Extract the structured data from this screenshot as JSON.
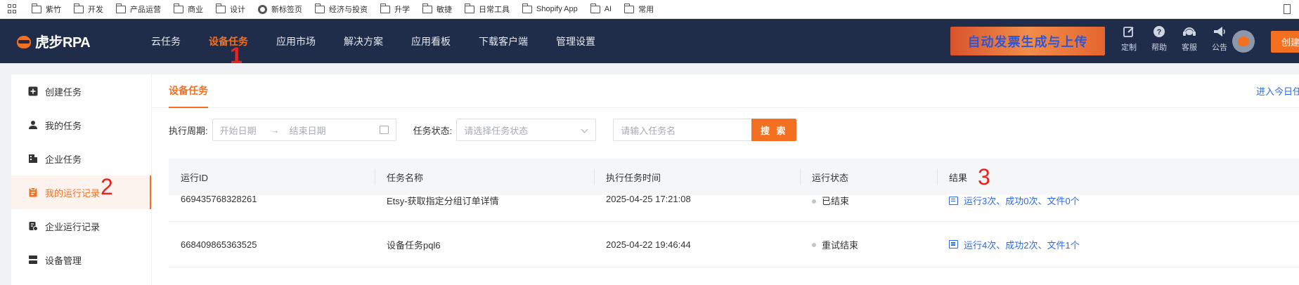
{
  "bookmarks": [
    {
      "label": "紫竹",
      "icon": "folder-icon"
    },
    {
      "label": "开发",
      "icon": "folder-icon"
    },
    {
      "label": "产品运营",
      "icon": "folder-icon"
    },
    {
      "label": "商业",
      "icon": "folder-icon"
    },
    {
      "label": "设计",
      "icon": "folder-icon"
    },
    {
      "label": "新标签页",
      "icon": "chrome-icon"
    },
    {
      "label": "经济与投资",
      "icon": "folder-icon"
    },
    {
      "label": "升学",
      "icon": "folder-icon"
    },
    {
      "label": "敏捷",
      "icon": "folder-icon"
    },
    {
      "label": "日常工具",
      "icon": "folder-icon"
    },
    {
      "label": "Shopify App",
      "icon": "folder-icon"
    },
    {
      "label": "AI",
      "icon": "folder-icon"
    },
    {
      "label": "常用",
      "icon": "folder-icon"
    }
  ],
  "header": {
    "logo_text": "虎步RPA",
    "nav": [
      "云任务",
      "设备任务",
      "应用市场",
      "解决方案",
      "应用看板",
      "下载客户端",
      "管理设置"
    ],
    "active_nav": "设备任务",
    "promo": "自动发票生成与上传",
    "tools": [
      {
        "label": "定制",
        "icon": "edit-icon"
      },
      {
        "label": "帮助",
        "icon": "help-icon"
      },
      {
        "label": "客服",
        "icon": "headset-icon"
      },
      {
        "label": "公告",
        "icon": "megaphone-icon"
      }
    ],
    "create_label": "创建"
  },
  "annotations": {
    "one": "1",
    "two": "2",
    "three": "3"
  },
  "sidebar": {
    "items": [
      {
        "label": "创建任务",
        "icon": "plus-square-icon"
      },
      {
        "label": "我的任务",
        "icon": "user-icon"
      },
      {
        "label": "企业任务",
        "icon": "building-icon"
      },
      {
        "label": "我的运行记录",
        "icon": "clipboard-icon",
        "active": true
      },
      {
        "label": "企业运行记录",
        "icon": "record-icon"
      },
      {
        "label": "设备管理",
        "icon": "server-icon"
      }
    ]
  },
  "main": {
    "tab": "设备任务",
    "today_link": "进入今日任",
    "filters": {
      "period_label": "执行周期:",
      "start_placeholder": "开始日期",
      "arrow": "→",
      "end_placeholder": "结束日期",
      "status_label": "任务状态:",
      "status_placeholder": "请选择任务状态",
      "name_placeholder": "请输入任务名",
      "search_label": "搜 索"
    },
    "table": {
      "headers": [
        "运行ID",
        "任务名称",
        "执行任务时间",
        "运行状态",
        "结果"
      ],
      "rows": [
        {
          "id": "669435768328261",
          "name": "Etsy-获取指定分组订单详情",
          "time": "2025-04-25 17:21:08",
          "status": "已结束",
          "result": "运行3次、成功0次、文件0个"
        },
        {
          "id": "668409865363525",
          "name": "设备任务pql6",
          "time": "2025-04-22 19:46:44",
          "status": "重试结束",
          "result": "运行4次、成功2次、文件1个"
        }
      ]
    }
  },
  "colors": {
    "accent": "#f37021",
    "nav_bg": "#1f2d4b",
    "link": "#2f6ae5",
    "annotation": "#e5261f"
  }
}
